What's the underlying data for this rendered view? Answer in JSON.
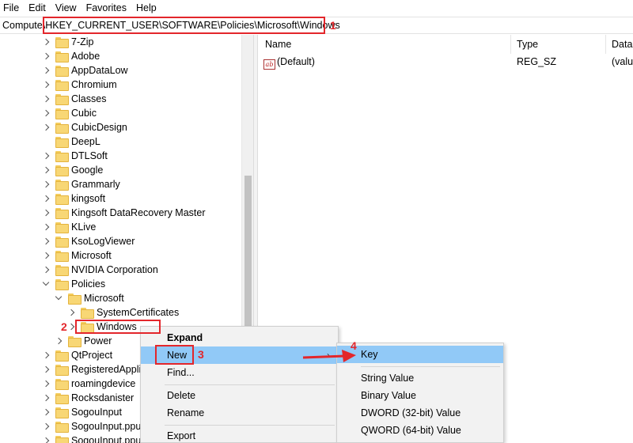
{
  "menu": {
    "file": "File",
    "edit": "Edit",
    "view": "View",
    "favorites": "Favorites",
    "help": "Help"
  },
  "address": {
    "prefix": "Compute",
    "path": "\\HKEY_CURRENT_USER\\SOFTWARE\\Policies\\Microsoft\\Windows"
  },
  "tree": {
    "items": [
      "7-Zip",
      "Adobe",
      "AppDataLow",
      "Chromium",
      "Classes",
      "Cubic",
      "CubicDesign",
      "DeepL",
      "DTLSoft",
      "Google",
      "Grammarly",
      "kingsoft",
      "Kingsoft DataRecovery Master",
      "KLive",
      "KsoLogViewer",
      "Microsoft",
      "NVIDIA Corporation",
      "Policies",
      "Microsoft",
      "SystemCertificates",
      "Windows",
      "Power",
      "QtProject",
      "RegisteredApplic",
      "roamingdevice",
      "Rocksdanister",
      "SogouInput",
      "SogouInput.ppup",
      "SogouInput.ppup"
    ]
  },
  "list": {
    "col_name": "Name",
    "col_type": "Type",
    "col_data": "Data",
    "row_name": "(Default)",
    "row_icon_text": "ab",
    "row_type": "REG_SZ",
    "row_data": "(valu"
  },
  "context_menu": {
    "expand": "Expand",
    "new": "New",
    "find": "Find...",
    "delete": "Delete",
    "rename": "Rename",
    "export": "Export"
  },
  "submenu": {
    "key": "Key",
    "string": "String Value",
    "binary": "Binary Value",
    "dword": "DWORD (32-bit) Value",
    "qword": "QWORD (64-bit) Value"
  },
  "annotations": {
    "step1": "1",
    "step2": "2",
    "step3": "3",
    "step4": "4",
    "color": "#e3262b"
  },
  "colors": {
    "highlight": "#91c9f7",
    "folder": "#f8d775"
  }
}
